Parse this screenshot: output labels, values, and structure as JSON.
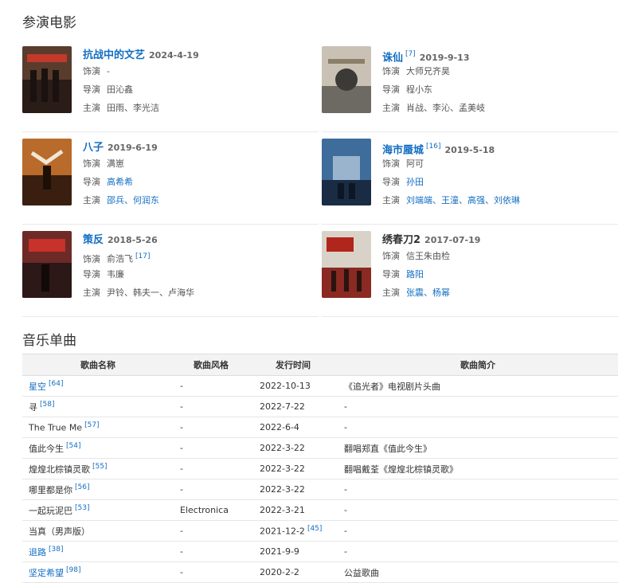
{
  "films_section": {
    "title": "参演电影"
  },
  "films": [
    {
      "name": "抗战中的文艺",
      "date": "2024-4-19",
      "ref": "",
      "role_label": "饰演",
      "role": "-",
      "director_label": "导演",
      "director": "田沁鑫",
      "cast_label": "主演",
      "cast": "田雨、李光洁",
      "poster_colors": [
        "#5a3c2c",
        "#2a1c16"
      ]
    },
    {
      "name": "诛仙",
      "date": "2019-9-13",
      "ref": "[7]",
      "role_label": "饰演",
      "role": "大师兄齐昊",
      "director_label": "导演",
      "director": "程小东",
      "cast_label": "主演",
      "cast": "肖战、李沁、孟美岐",
      "poster_colors": [
        "#c9c2b4",
        "#6d6a63"
      ]
    },
    {
      "name": "八子",
      "date": "2019-6-19",
      "ref": "",
      "role_label": "饰演",
      "role": "满崽",
      "director_label": "导演",
      "director": "高希希",
      "cast_label": "主演",
      "cast": "邵兵、何润东",
      "poster_colors": [
        "#b86b2a",
        "#3a1f10"
      ]
    },
    {
      "name": "海市蜃城",
      "date": "2019-5-18",
      "ref": "[16]",
      "role_label": "饰演",
      "role": "阿可",
      "director_label": "导演",
      "director": "孙田",
      "cast_label": "主演",
      "cast": "刘端端、王潼、高强、刘依琳",
      "poster_colors": [
        "#3f6d9b",
        "#1a2c44"
      ]
    },
    {
      "name": "策反",
      "date": "2018-5-26",
      "ref": "",
      "role_label": "饰演",
      "role": "俞浩飞",
      "role_ref": "[17]",
      "director_label": "导演",
      "director": "韦廉",
      "cast_label": "主演",
      "cast": "尹铃、韩夫一、卢海华",
      "poster_colors": [
        "#6e2a26",
        "#2b1817"
      ]
    },
    {
      "name": "绣春刀2",
      "date": "2017-07-19",
      "ref": "",
      "role_label": "饰演",
      "role": "信王朱由检",
      "director_label": "导演",
      "director": "路阳",
      "cast_label": "主演",
      "cast": "张震、杨幂",
      "poster_colors": [
        "#d9d2c8",
        "#8a2a22"
      ]
    }
  ],
  "music_section": {
    "title": "音乐单曲"
  },
  "songs_table": {
    "headers": [
      "歌曲名称",
      "歌曲风格",
      "发行时间",
      "歌曲简介"
    ],
    "rows": [
      {
        "name": "星空",
        "ref": "[64]",
        "style": "-",
        "date": "2022-10-13",
        "date_ref": "",
        "desc": "《追光者》电视剧片头曲"
      },
      {
        "name": "寻",
        "ref": "[58]",
        "style": "-",
        "date": "2022-7-22",
        "date_ref": "",
        "desc": "-"
      },
      {
        "name": "The True Me",
        "ref": "[57]",
        "style": "-",
        "date": "2022-6-4",
        "date_ref": "",
        "desc": "-"
      },
      {
        "name": "值此今生",
        "ref": "[54]",
        "style": "-",
        "date": "2022-3-22",
        "date_ref": "",
        "desc": "翻唱郑直《值此今生》"
      },
      {
        "name": "煌煌北棕镇灵歌",
        "ref": "[55]",
        "style": "-",
        "date": "2022-3-22",
        "date_ref": "",
        "desc": "翻唱戴荃《煌煌北棕镇灵歌》"
      },
      {
        "name": "哪里都是你",
        "ref": "[56]",
        "style": "-",
        "date": "2022-3-22",
        "date_ref": "",
        "desc": "-"
      },
      {
        "name": "一起玩泥巴",
        "ref": "[53]",
        "style": "Electronica",
        "date": "2022-3-21",
        "date_ref": "",
        "desc": "-"
      },
      {
        "name": "当真（男声版）",
        "ref": "",
        "style": "-",
        "date": "2021-12-2",
        "date_ref": "[45]",
        "desc": "-"
      },
      {
        "name": "退路",
        "ref": "[38]",
        "style": "-",
        "date": "2021-9-9",
        "date_ref": "",
        "desc": "-"
      },
      {
        "name": "坚定希望",
        "ref": "[98]",
        "style": "-",
        "date": "2020-2-2",
        "date_ref": "",
        "desc": "公益歌曲"
      }
    ]
  },
  "colors": {
    "link": "#136ec2",
    "text": "#333333",
    "header_bg": "#f3f3f3"
  }
}
